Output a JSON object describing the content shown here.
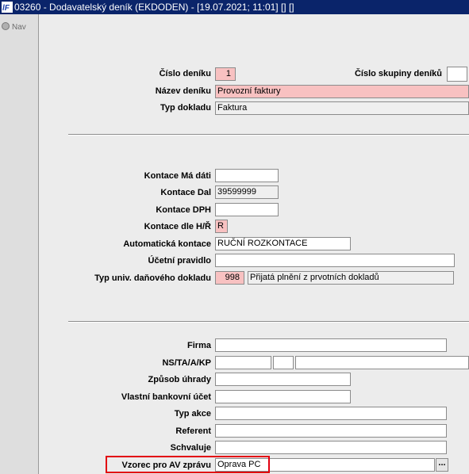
{
  "window": {
    "title": "03260 - Dodavatelský deník (EKDODEN) - [19.07.2021; 11:01] [] []"
  },
  "nav": {
    "label": "Nav"
  },
  "form": {
    "cislo_deniku": {
      "label": "Číslo deníku",
      "value": "1"
    },
    "cislo_skupiny": {
      "label": "Číslo skupiny deníků",
      "value": ""
    },
    "nazev_deniku": {
      "label": "Název deníku",
      "value": "Provozní faktury"
    },
    "typ_dokladu": {
      "label": "Typ dokladu",
      "value": "Faktura"
    },
    "kontace_ma_dati": {
      "label": "Kontace Má dáti",
      "value": ""
    },
    "kontace_dal": {
      "label": "Kontace Dal",
      "value": "39599999"
    },
    "kontace_dph": {
      "label": "Kontace DPH",
      "value": ""
    },
    "kontace_hr": {
      "label": "Kontace dle H/Ř",
      "value": "R"
    },
    "automaticka_kontace": {
      "label": "Automatická kontace",
      "value": "RUČNÍ ROZKONTACE"
    },
    "ucetni_pravidlo": {
      "label": "Účetní pravidlo",
      "value": ""
    },
    "typ_univ": {
      "label": "Typ univ. daňového dokladu",
      "code": "998",
      "desc": "Přijatá plnění z prvotních dokladů"
    },
    "firma": {
      "label": "Firma",
      "value": ""
    },
    "ns_ta": {
      "label": "NS/TA/A/KP",
      "v1": "",
      "v2": "",
      "v3": ""
    },
    "zpusob_uhrady": {
      "label": "Způsob úhrady",
      "value": ""
    },
    "vlastni_ucet": {
      "label": "Vlastní bankovní účet",
      "value": ""
    },
    "typ_akce": {
      "label": "Typ akce",
      "value": ""
    },
    "referent": {
      "label": "Referent",
      "value": ""
    },
    "schvaluje": {
      "label": "Schvaluje",
      "value": ""
    },
    "vzorec_av": {
      "label": "Vzorec pro AV zprávu",
      "value": "Oprava PC",
      "lookup": "..."
    }
  },
  "colors": {
    "titlebar": "#0a246a",
    "required": "#f8c1c1",
    "highlight": "#e2000f"
  },
  "icons": {
    "app_logo": "app-logo-icon",
    "nav_radio": "radio-icon"
  }
}
